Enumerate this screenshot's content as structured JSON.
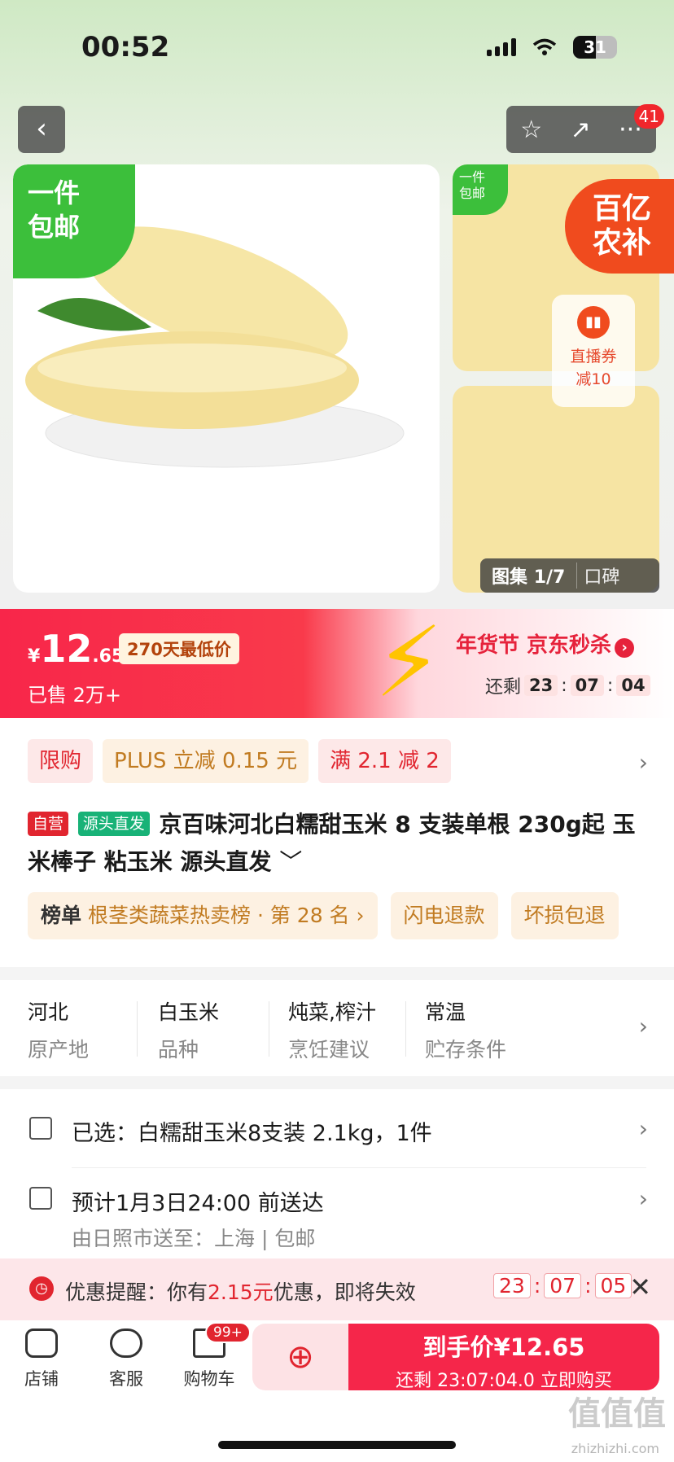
{
  "status_bar": {
    "time": "00:52",
    "battery": "31"
  },
  "header": {
    "back_icon": "‹",
    "star_icon": "☆",
    "share_icon": "↗",
    "more_icon": "···",
    "notification_count": "41"
  },
  "gallery": {
    "free_shipping_tag": "一件\n包邮",
    "mini_free_tag": "一件\n包邮",
    "subsidy_badge": "百亿\n农补",
    "live_coupon_line1": "直播券",
    "live_coupon_line2": "减10",
    "gallery_label": "图集",
    "gallery_index": "1/7",
    "reviews_label": "口碑"
  },
  "price_banner": {
    "currency": "¥",
    "price_int": "12",
    "price_dec": ".65",
    "lowest_badge": "270天最低价",
    "sold": "已售 2万+",
    "festival": "年货节 京东秒杀",
    "remaining_label": "还剩",
    "countdown": [
      "23",
      "07",
      "04"
    ]
  },
  "promos": [
    {
      "label": "限购",
      "style": "red"
    },
    {
      "label": "PLUS 立减 0.15 元",
      "style": "gold"
    },
    {
      "label": "满 2.1 减 2",
      "style": "red"
    }
  ],
  "product": {
    "tag_self": "自营",
    "tag_source": "源头直发",
    "title": "京百味河北白糯甜玉米 8 支装单根 230g起 玉米棒子 粘玉米 源头直发",
    "expand_icon": "﹀"
  },
  "chips": [
    {
      "bold": "榜单",
      "text": "根茎类蔬菜热卖榜 · 第 28 名 ›"
    },
    {
      "bold": "",
      "text": "闪电退款"
    },
    {
      "bold": "",
      "text": "坏损包退"
    }
  ],
  "specs": [
    {
      "value": "河北",
      "key": "原产地"
    },
    {
      "value": "白玉米",
      "key": "品种"
    },
    {
      "value": "炖菜,榨汁",
      "key": "烹饪建议"
    },
    {
      "value": "常温",
      "key": "贮存条件"
    }
  ],
  "selection": {
    "selected": "已选：白糯甜玉米8支装 2.1kg，1件",
    "delivery": "预计1月3日24:00 前送达",
    "ship_from": "由日照市送至：上海 | 包邮"
  },
  "reminder": {
    "prefix": "优惠提醒：你有",
    "amount": "2.15元",
    "suffix": "优惠，即将失效",
    "countdown": [
      "23",
      "07",
      "05"
    ],
    "close_icon": "✕"
  },
  "bottom_bar": {
    "store": "店铺",
    "service": "客服",
    "cart": "购物车",
    "cart_badge": "99+",
    "buy_line1": "到手价¥12.65",
    "buy_line2": "还剩 23:07:04.0 立即购买"
  },
  "watermark": {
    "main": "值值值",
    "sub": "zhizhizhi.com"
  },
  "colors": {
    "accent_red": "#f5264a",
    "gold": "#c17b21",
    "green": "#3cbf3b"
  }
}
